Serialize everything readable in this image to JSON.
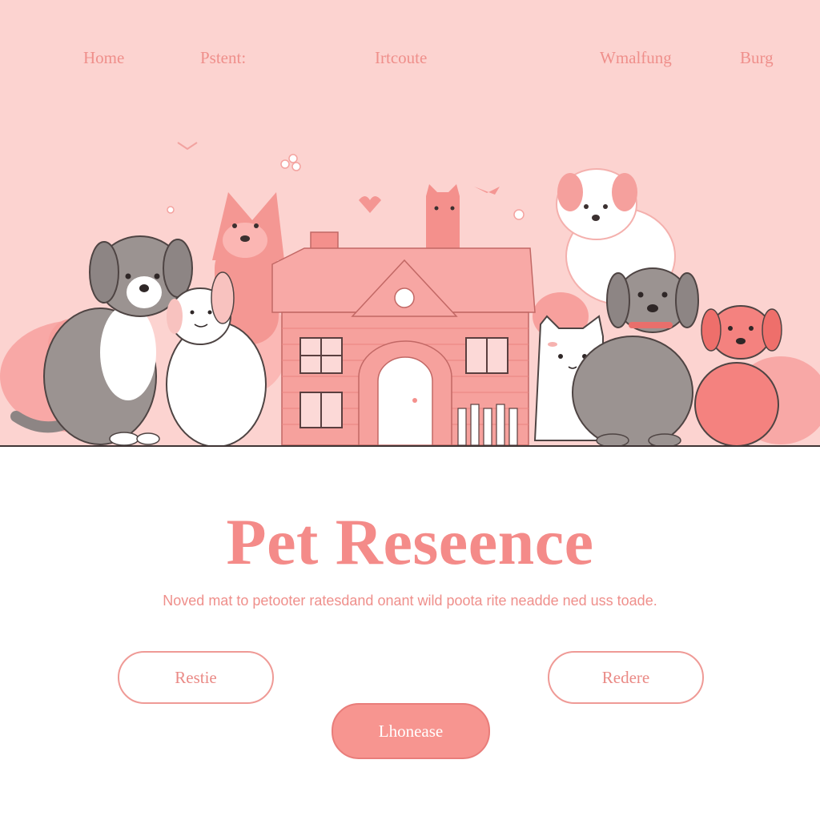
{
  "nav": {
    "items": [
      "Home",
      "Pstent:",
      "Irtcoute",
      "Wmalfung",
      "Burg"
    ]
  },
  "hero": {
    "title": "Pet Reseence",
    "subtitle": "Noved mat to petooter ratesdand onant wild poota rite neadde ned uss toade."
  },
  "buttons": {
    "left": "Restie",
    "right": "Redere",
    "primary": "Lhonease"
  },
  "colors": {
    "accent": "#f48b89",
    "hero_bg": "#fcd3d0",
    "button_fill": "#f79590"
  }
}
